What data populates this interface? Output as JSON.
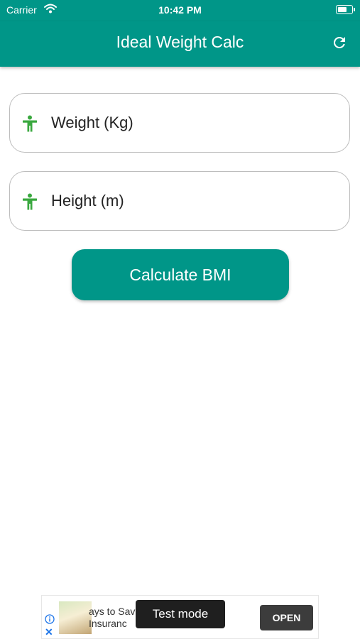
{
  "status_bar": {
    "carrier": "Carrier",
    "time": "10:42 PM",
    "wifi_icon": "wifi-icon",
    "battery_icon": "battery-icon"
  },
  "app_bar": {
    "title": "Ideal Weight Calc",
    "refresh_icon": "refresh-icon",
    "background_color": "#009688"
  },
  "form": {
    "weight_placeholder": "Weight (Kg)",
    "weight_value": "",
    "weight_icon": "accessibility-person-icon",
    "height_placeholder": "Height (m)",
    "height_value": "",
    "height_icon": "accessibility-person-icon",
    "icon_color": "#3aa83f",
    "calculate_label": "Calculate BMI",
    "button_color": "#009688"
  },
  "ad": {
    "text_line1": "ays to Sav",
    "text_line2": "Insuranc",
    "test_mode_label": "Test mode",
    "open_label": "OPEN",
    "info_icon": "info-icon",
    "close_icon": "close-icon"
  }
}
